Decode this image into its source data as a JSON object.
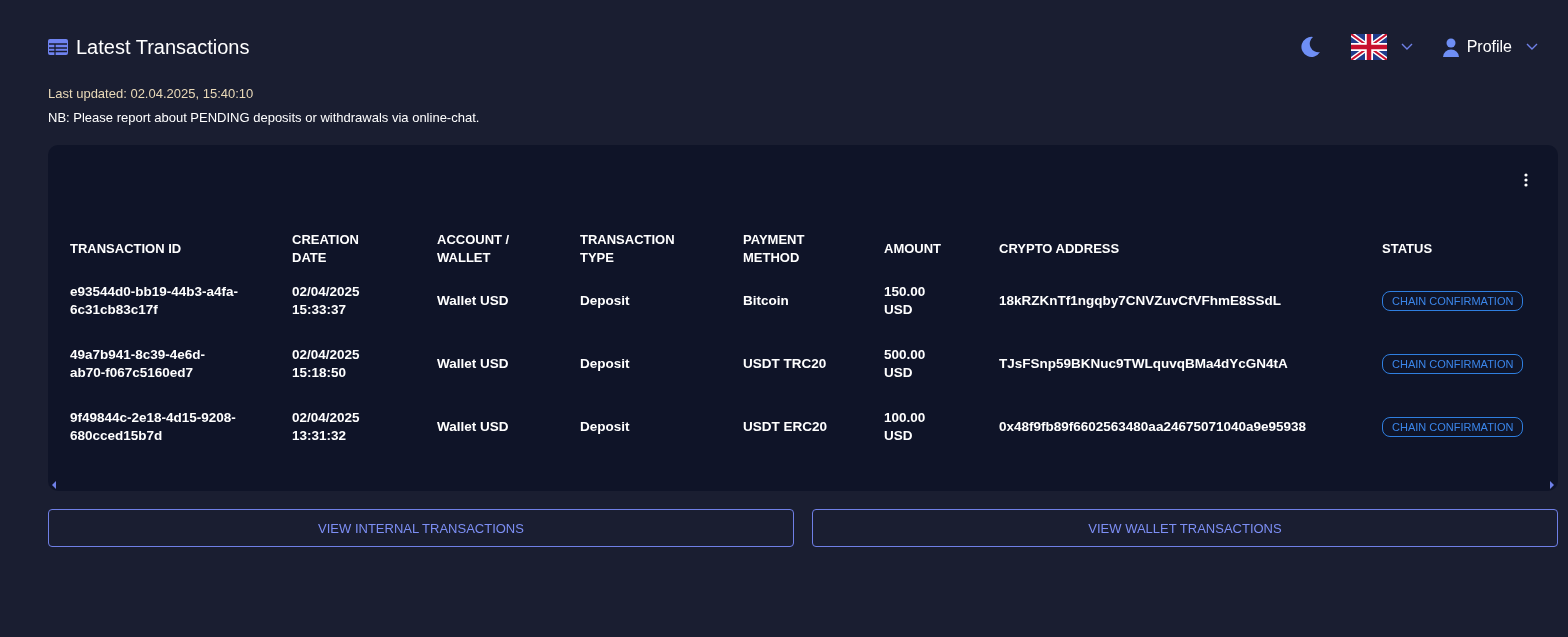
{
  "header": {
    "title": "Latest Transactions",
    "profile": "Profile"
  },
  "last_updated": "Last updated: 02.04.2025, 15:40:10",
  "notice": "NB: Please report about PENDING deposits or withdrawals via online-chat.",
  "table": {
    "columns": [
      "TRANSACTION ID",
      "CREATION DATE",
      "ACCOUNT / WALLET",
      "TRANSACTION TYPE",
      "PAYMENT METHOD",
      "AMOUNT",
      "CRYPTO ADDRESS",
      "STATUS"
    ],
    "rows": [
      {
        "id": "e93544d0-bb19-44b3-a4fa-6c31cb83c17f",
        "date": "02/04/2025 15:33:37",
        "account": "Wallet USD",
        "type": "Deposit",
        "method": "Bitcoin",
        "amount": "150.00 USD",
        "address": "18kRZKnTf1ngqby7CNVZuvCfVFhmE8SSdL",
        "status": "CHAIN CONFIRMATION"
      },
      {
        "id": "49a7b941-8c39-4e6d-ab70-f067c5160ed7",
        "date": "02/04/2025 15:18:50",
        "account": "Wallet USD",
        "type": "Deposit",
        "method": "USDT TRC20",
        "amount": "500.00 USD",
        "address": "TJsFSnp59BKNuc9TWLquvqBMa4dYcGN4tA",
        "status": "CHAIN CONFIRMATION"
      },
      {
        "id": "9f49844c-2e18-4d15-9208-680cced15b7d",
        "date": "02/04/2025 13:31:32",
        "account": "Wallet USD",
        "type": "Deposit",
        "method": "USDT ERC20",
        "amount": "100.00 USD",
        "address": "0x48f9fb89f6602563480aa24675071040a9e95938",
        "status": "CHAIN CONFIRMATION"
      }
    ]
  },
  "buttons": [
    "VIEW INTERNAL TRANSACTIONS",
    "VIEW WALLET TRANSACTIONS"
  ]
}
